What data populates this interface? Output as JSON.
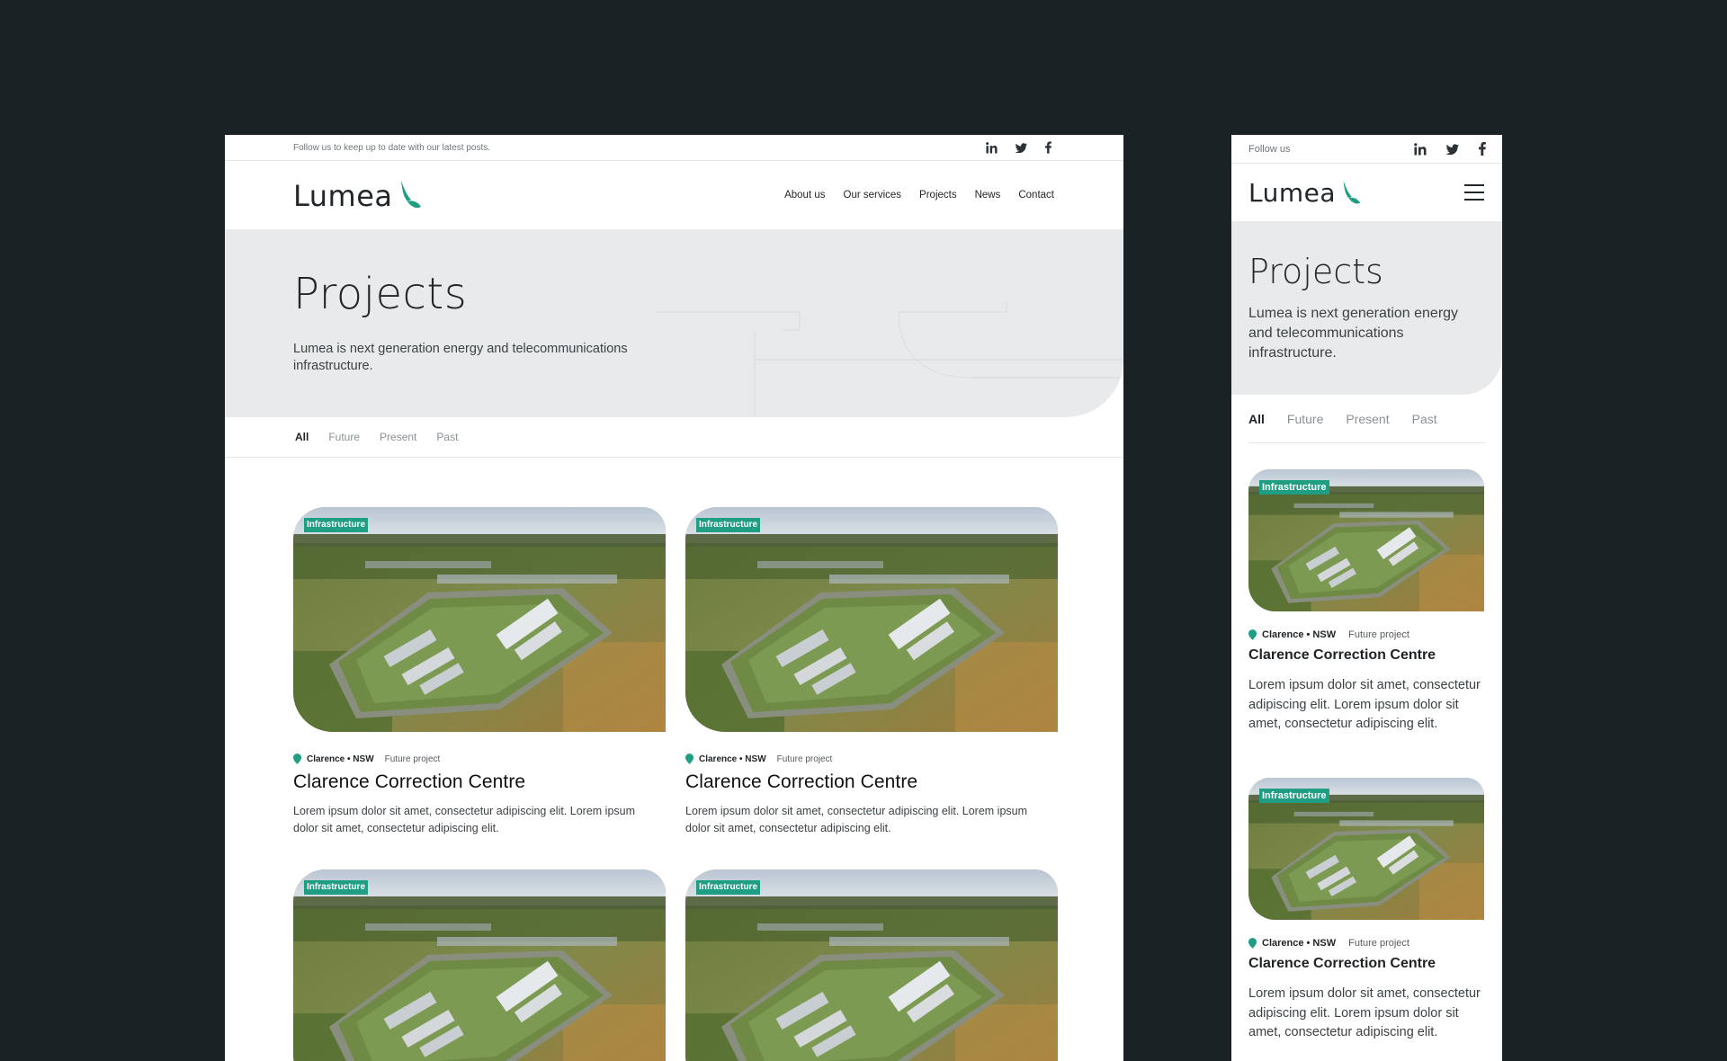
{
  "desktop": {
    "topbar_text": "Follow us to keep up to date with our latest posts.",
    "brand": "Lumea",
    "nav": [
      "About us",
      "Our services",
      "Projects",
      "News",
      "Contact"
    ],
    "hero_title": "Projects",
    "hero_text": "Lumea is next generation energy and telecommunications infrastructure.",
    "filters": [
      "All",
      "Future",
      "Present",
      "Past"
    ],
    "active_filter": "All",
    "cards": [
      {
        "tag": "Infrastructure",
        "location": "Clarence • NSW",
        "status": "Future project",
        "title": "Clarence Correction Centre",
        "text": "Lorem ipsum dolor sit amet, consectetur adipiscing elit.  Lorem ipsum dolor sit amet, consectetur adipiscing elit."
      },
      {
        "tag": "Infrastructure",
        "location": "Clarence • NSW",
        "status": "Future project",
        "title": "Clarence Correction Centre",
        "text": "Lorem ipsum dolor sit amet, consectetur adipiscing elit.  Lorem ipsum dolor sit amet, consectetur adipiscing elit."
      },
      {
        "tag": "Infrastructure"
      },
      {
        "tag": "Infrastructure"
      }
    ]
  },
  "mobile": {
    "topbar_text": "Follow us",
    "brand": "Lumea",
    "hero_title": "Projects",
    "hero_text": "Lumea is next generation energy and telecommunications infrastructure.",
    "filters": [
      "All",
      "Future",
      "Present",
      "Past"
    ],
    "active_filter": "All",
    "cards": [
      {
        "tag": "Infrastructure",
        "location": "Clarence • NSW",
        "status": "Future project",
        "title": "Clarence Correction Centre",
        "text": "Lorem ipsum dolor sit amet, consectetur adipiscing elit.  Lorem ipsum dolor sit amet, consectetur adipiscing elit."
      },
      {
        "tag": "Infrastructure",
        "location": "Clarence • NSW",
        "status": "Future project",
        "title": "Clarence Correction Centre",
        "text": "Lorem ipsum dolor sit amet, consectetur adipiscing elit.  Lorem ipsum dolor sit amet, consectetur adipiscing elit."
      }
    ]
  },
  "icons": {
    "social": [
      "linkedin-icon",
      "twitter-icon",
      "facebook-icon"
    ],
    "brand_leaf": "leaf-logo-icon",
    "menu": "hamburger-menu-icon",
    "location": "location-pin-icon"
  },
  "colors": {
    "background": "#1b2225",
    "accent": "#1f9e83",
    "hero": "#e9eaeb",
    "text": "#1f2326"
  }
}
